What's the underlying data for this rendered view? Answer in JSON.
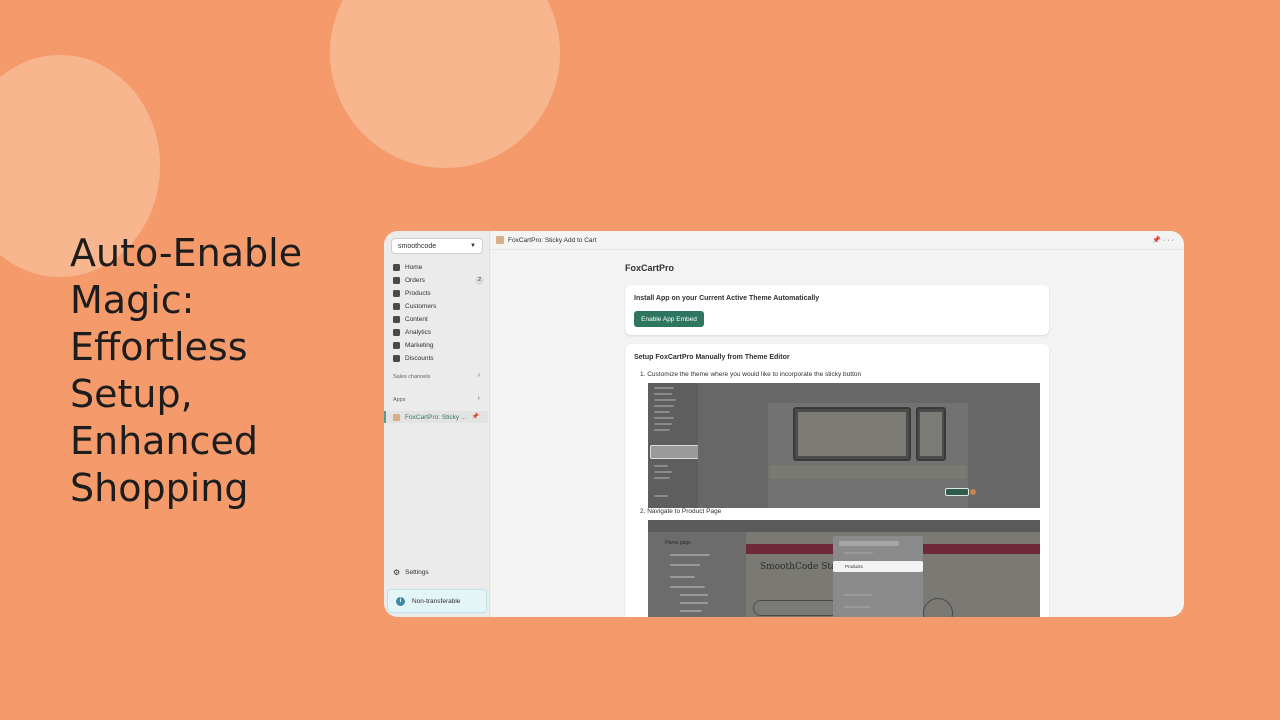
{
  "headline": {
    "lines": [
      "Auto-Enable",
      "Magic:",
      "Effortless",
      "Setup,",
      "Enhanced",
      "Shopping"
    ]
  },
  "sidebar": {
    "store": "smoothcode",
    "items": [
      {
        "label": "Home",
        "icon": "home-icon"
      },
      {
        "label": "Orders",
        "icon": "orders-icon",
        "badge": "2"
      },
      {
        "label": "Products",
        "icon": "tag-icon"
      },
      {
        "label": "Customers",
        "icon": "person-icon"
      },
      {
        "label": "Content",
        "icon": "content-icon"
      },
      {
        "label": "Analytics",
        "icon": "chart-icon"
      },
      {
        "label": "Marketing",
        "icon": "target-icon"
      },
      {
        "label": "Discounts",
        "icon": "discount-icon"
      }
    ],
    "sales_channels": "Sales channels",
    "apps": "Apps",
    "app_item": "FoxCartPro: Sticky ...",
    "settings": "Settings",
    "non_transferable": "Non-transferable"
  },
  "topbar": {
    "title": "FoxCartPro: Sticky Add to Cart"
  },
  "main": {
    "page_title": "FoxCartPro",
    "card1": {
      "title": "Install App on your Current Active Theme Automatically",
      "button": "Enable App Embed"
    },
    "card2": {
      "title": "Setup FoxCartPro Manually from Theme Editor",
      "step1": "1. Customize the theme where you would like to incorporate the sticky button",
      "step2": "2. Navigate to Product Page"
    }
  },
  "screenshot2": {
    "page_name": "Home page",
    "store_title": "SmoothCode Staging",
    "menu_item": "Products"
  },
  "colors": {
    "background": "#f59b6b",
    "accent_green": "#2e7660"
  }
}
